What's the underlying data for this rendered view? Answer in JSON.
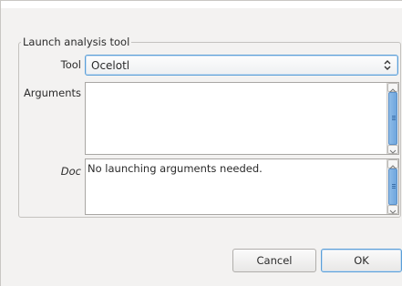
{
  "dialog": {
    "group_title": "Launch analysis tool",
    "tool": {
      "label": "Tool",
      "selected": "Ocelotl"
    },
    "arguments": {
      "label": "Arguments",
      "value": ""
    },
    "doc": {
      "label": "Doc",
      "text": "No launching arguments needed."
    },
    "buttons": {
      "cancel": "Cancel",
      "ok": "OK"
    }
  },
  "icons": {
    "select_arrows": "up-down-chevron-icon",
    "scroll_up": "scroll-up-arrow-icon",
    "scroll_down": "scroll-down-arrow-icon"
  },
  "colors": {
    "accent": "#5b9fd8",
    "window_bg": "#f3f2f1"
  }
}
